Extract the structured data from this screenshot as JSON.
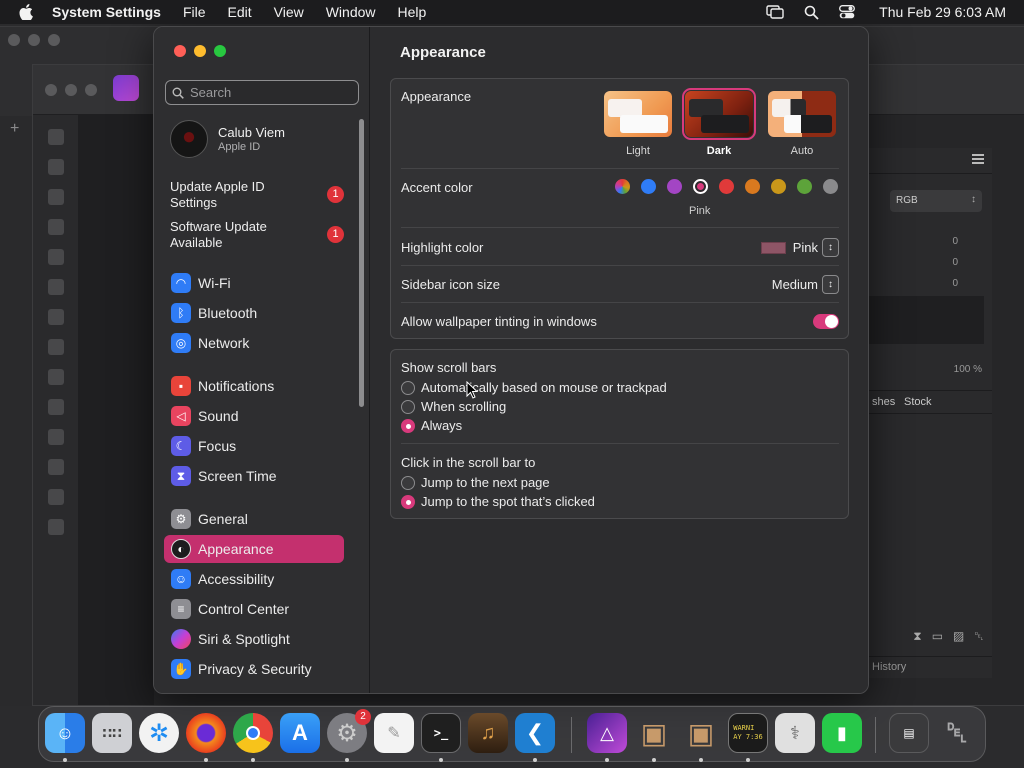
{
  "menubar": {
    "app_name": "System Settings",
    "items": [
      "File",
      "Edit",
      "View",
      "Window",
      "Help"
    ],
    "clock": "Thu Feb 29  6:03 AM",
    "icons": [
      "apple-logo-icon",
      "screen-mirroring-icon",
      "spotlight-search-icon",
      "control-center-icon"
    ]
  },
  "background_app": {
    "name": "Affinity Photo",
    "color_mode": "RGB",
    "values": [
      "0",
      "0",
      "0"
    ],
    "zoom": "100 %",
    "tabs": [
      "shes",
      "Stock"
    ],
    "history_label": "History"
  },
  "sidebar": {
    "search_placeholder": "Search",
    "profile": {
      "name": "Calub Viem",
      "subtitle": "Apple ID"
    },
    "updates": [
      {
        "line1": "Update Apple ID",
        "line2": "Settings",
        "badge": "1"
      },
      {
        "line1": "Software Update",
        "line2": "Available",
        "badge": "1"
      }
    ],
    "items": [
      {
        "label": "Wi-Fi",
        "icon": "wifi-icon",
        "color": "#2f7cf6"
      },
      {
        "label": "Bluetooth",
        "icon": "bluetooth-icon",
        "color": "#2f7cf6"
      },
      {
        "label": "Network",
        "icon": "globe-icon",
        "color": "#2f7cf6"
      },
      {
        "label": "Notifications",
        "icon": "bell-icon",
        "color": "#e8443a"
      },
      {
        "label": "Sound",
        "icon": "speaker-icon",
        "color": "#e8445f"
      },
      {
        "label": "Focus",
        "icon": "moon-icon",
        "color": "#5e5ce6"
      },
      {
        "label": "Screen Time",
        "icon": "hourglass-icon",
        "color": "#5e5ce6"
      },
      {
        "label": "General",
        "icon": "gear-icon",
        "color": "#8e8e93"
      },
      {
        "label": "Appearance",
        "icon": "appearance-icon",
        "color": "#1c1c1e"
      },
      {
        "label": "Accessibility",
        "icon": "accessibility-icon",
        "color": "#2f7cf6"
      },
      {
        "label": "Control Center",
        "icon": "control-center-icon",
        "color": "#8e8e93"
      },
      {
        "label": "Siri & Spotlight",
        "icon": "siri-icon",
        "color": "#b046d8"
      },
      {
        "label": "Privacy & Security",
        "icon": "hand-icon",
        "color": "#2f7cf6"
      }
    ],
    "active": "Appearance"
  },
  "content": {
    "title": "Appearance",
    "appearance_label": "Appearance",
    "modes": [
      {
        "label": "Light",
        "selected": false
      },
      {
        "label": "Dark",
        "selected": true
      },
      {
        "label": "Auto",
        "selected": false
      }
    ],
    "accent_label": "Accent color",
    "accent_colors": [
      {
        "name": "multicolor",
        "color": "conic"
      },
      {
        "name": "blue",
        "color": "#2f7cf6"
      },
      {
        "name": "purple",
        "color": "#a345c4"
      },
      {
        "name": "pink",
        "color": "#d83a7c"
      },
      {
        "name": "red",
        "color": "#e03a3a"
      },
      {
        "name": "orange",
        "color": "#d9791f"
      },
      {
        "name": "yellow",
        "color": "#c9971a"
      },
      {
        "name": "green",
        "color": "#5da33a"
      },
      {
        "name": "graphite",
        "color": "#8a8a8c"
      }
    ],
    "accent_selected_label": "Pink",
    "highlight_label": "Highlight color",
    "highlight_value": "Pink",
    "sidebar_icon_label": "Sidebar icon size",
    "sidebar_icon_value": "Medium",
    "tinting_label": "Allow wallpaper tinting in windows",
    "tinting_on": true,
    "scrollbars_label": "Show scroll bars",
    "scrollbar_options": [
      {
        "label": "Automatically based on mouse or trackpad",
        "selected": false
      },
      {
        "label": "When scrolling",
        "selected": false
      },
      {
        "label": "Always",
        "selected": true
      }
    ],
    "click_label": "Click in the scroll bar to",
    "click_options": [
      {
        "label": "Jump to the next page",
        "selected": false
      },
      {
        "label": "Jump to the spot that’s clicked",
        "selected": true
      }
    ],
    "help": "?"
  },
  "dock": {
    "apps": [
      {
        "name": "finder-icon",
        "color": "#2a8bf0"
      },
      {
        "name": "launchpad-icon",
        "color": "#d0d0d4"
      },
      {
        "name": "safari-icon",
        "color": "#1e8cf2"
      },
      {
        "name": "firefox-icon",
        "color": "#e8531f"
      },
      {
        "name": "chrome-icon",
        "color": "#f2f2f2"
      },
      {
        "name": "app-store-icon",
        "color": "#1d8ff2"
      },
      {
        "name": "system-settings-icon",
        "color": "#8c8c90",
        "badge": "2"
      },
      {
        "name": "textedit-icon",
        "color": "#f0f0f0"
      },
      {
        "name": "terminal-icon",
        "color": "#1f1f1f"
      },
      {
        "name": "garageband-icon",
        "color": "#4a3422"
      },
      {
        "name": "vscode-icon",
        "color": "#1f7fd1"
      },
      {
        "name": "affinity-photo-icon",
        "color": "#8a3cc8"
      },
      {
        "name": "package-icon",
        "color": "#c79a6a"
      },
      {
        "name": "package-icon-2",
        "color": "#c79a6a"
      },
      {
        "name": "console-icon",
        "color": "#1d1d1d"
      },
      {
        "name": "disk-utility-icon",
        "color": "#d8d8d8"
      },
      {
        "name": "facetime-icon",
        "color": "#27c84a"
      },
      {
        "name": "downloads-stack-icon",
        "color": "#3a3a3c"
      },
      {
        "name": "trash-icon",
        "color": "#9a9a9c"
      }
    ],
    "console_text": "WARNI\nAY 7:36"
  }
}
